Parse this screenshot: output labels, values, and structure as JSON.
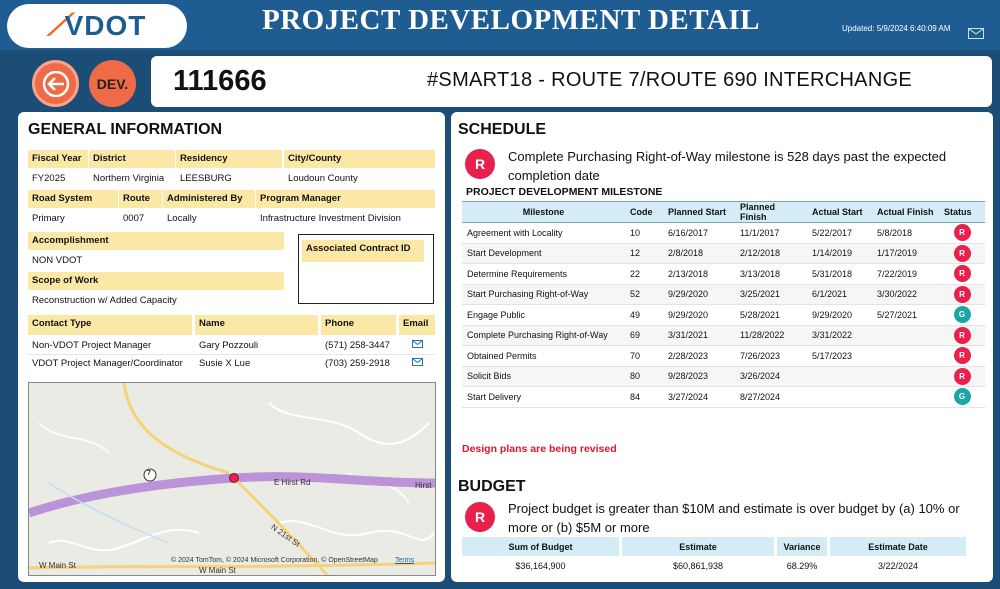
{
  "header": {
    "logo_text": "VDOT",
    "title": "PROJECT DEVELOPMENT DETAIL",
    "updated": "Updated: 5/9/2024 6:40:09 AM"
  },
  "nav": {
    "dev_label": "DEV."
  },
  "project": {
    "id": "111666",
    "name": "#SMART18 - ROUTE 7/ROUTE 690 INTERCHANGE"
  },
  "general": {
    "title": "GENERAL INFORMATION",
    "fiscal_year_label": "Fiscal Year",
    "fiscal_year": "FY2025",
    "district_label": "District",
    "district": "Northern Virginia",
    "residency_label": "Residency",
    "residency": "LEESBURG",
    "city_label": "City/County",
    "city": "Loudoun County",
    "road_system_label": "Road System",
    "road_system": "Primary",
    "route_label": "Route",
    "route": "0007",
    "administered_label": "Administered By",
    "administered": "Locally",
    "program_manager_label": "Program Manager",
    "program_manager": "Infrastructure Investment Division",
    "accomplishment_label": "Accomplishment",
    "accomplishment": "NON VDOT",
    "scope_label": "Scope of Work",
    "scope": "Reconstruction w/ Added Capacity",
    "contract_label": "Associated Contract ID",
    "contacts_headers": [
      "Contact Type",
      "Name",
      "Phone",
      "Email"
    ],
    "contacts": [
      {
        "type": "Non-VDOT Project Manager",
        "name": "Gary Pozzouli",
        "phone": "(571) 258-3447"
      },
      {
        "type": "VDOT Project Manager/Coordinator",
        "name": "Susie X Lue",
        "phone": "(703) 259-2918"
      }
    ]
  },
  "map": {
    "road_label_1": "E Hirst Rd",
    "road_label_2": "Hirst",
    "road_label_3": "N 21st St",
    "road_label_4": "W Main St",
    "road_label_5": "W Main St",
    "route_shield": "7",
    "attribution": "© 2024 TomTom, © 2024 Microsoft Corporation, © OpenStreetMap",
    "terms": "Terms"
  },
  "schedule": {
    "title": "SCHEDULE",
    "alert_badge": "R",
    "alert_text": "Complete Purchasing Right-of-Way milestone is 528 days past the expected completion date",
    "milestone_title": "PROJECT DEVELOPMENT MILESTONE",
    "headers": [
      "Milestone",
      "Code",
      "Planned Start",
      "Planned Finish",
      "Actual Start",
      "Actual Finish",
      "Status"
    ],
    "rows": [
      {
        "milestone": "Agreement with Locality",
        "code": "10",
        "ps": "6/16/2017",
        "pf": "11/1/2017",
        "as": "5/22/2017",
        "af": "5/8/2018",
        "status": "R"
      },
      {
        "milestone": "Start Development",
        "code": "12",
        "ps": "2/8/2018",
        "pf": "2/12/2018",
        "as": "1/14/2019",
        "af": "1/17/2019",
        "status": "R"
      },
      {
        "milestone": "Determine Requirements",
        "code": "22",
        "ps": "2/13/2018",
        "pf": "3/13/2018",
        "as": "5/31/2018",
        "af": "7/22/2019",
        "status": "R"
      },
      {
        "milestone": "Start Purchasing Right-of-Way",
        "code": "52",
        "ps": "9/29/2020",
        "pf": "3/25/2021",
        "as": "6/1/2021",
        "af": "3/30/2022",
        "status": "R"
      },
      {
        "milestone": "Engage Public",
        "code": "49",
        "ps": "9/29/2020",
        "pf": "5/28/2021",
        "as": "9/29/2020",
        "af": "5/27/2021",
        "status": "G"
      },
      {
        "milestone": "Complete Purchasing Right-of-Way",
        "code": "69",
        "ps": "3/31/2021",
        "pf": "11/28/2022",
        "as": "3/31/2022",
        "af": "",
        "status": "R"
      },
      {
        "milestone": "Obtained Permits",
        "code": "70",
        "ps": "2/28/2023",
        "pf": "7/26/2023",
        "as": "5/17/2023",
        "af": "",
        "status": "R"
      },
      {
        "milestone": "Solicit Bids",
        "code": "80",
        "ps": "9/28/2023",
        "pf": "3/26/2024",
        "as": "",
        "af": "",
        "status": "R"
      },
      {
        "milestone": "Start Delivery",
        "code": "84",
        "ps": "3/27/2024",
        "pf": "8/27/2024",
        "as": "",
        "af": "",
        "status": "G"
      }
    ],
    "note": "Design plans are being revised"
  },
  "budget": {
    "title": "BUDGET",
    "alert_badge": "R",
    "alert_text": "Project budget is greater than $10M and estimate is over budget by (a) 10% or more or (b) $5M or more",
    "headers": [
      "Sum of Budget",
      "Estimate",
      "Variance",
      "Estimate Date"
    ],
    "values": [
      "$36,164,900",
      "$60,861,938",
      "68.29%",
      "3/22/2024"
    ]
  },
  "colors": {
    "header_bg": "#1f5c92",
    "page_bg": "#1c4d76",
    "accent_orange": "#ef6b47",
    "red_status": "#e8214c",
    "green_status": "#1aa6a2",
    "label_yellow": "#fbe8a6",
    "table_header": "#d4ecf5"
  }
}
